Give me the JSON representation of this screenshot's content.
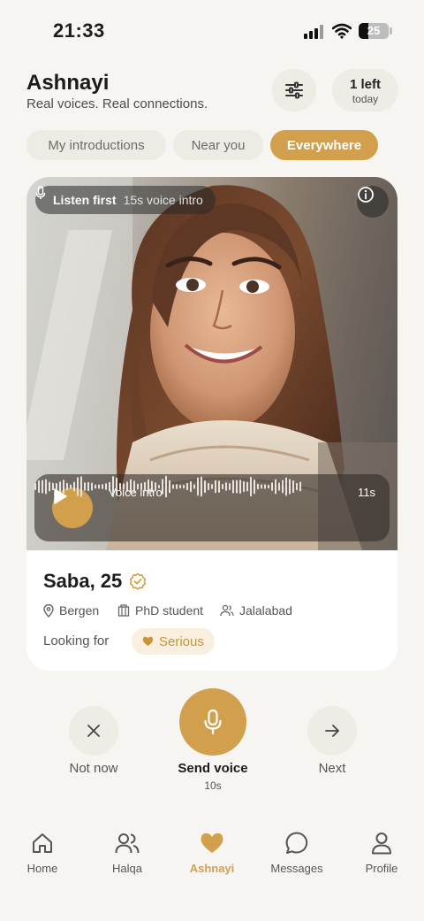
{
  "status_bar": {
    "time": "21:33",
    "battery": "25"
  },
  "header": {
    "app_name": "Ashnayi",
    "tagline": "Real voices. Real connections.",
    "remaining_count": "1 left",
    "remaining_period": "today"
  },
  "tabs": [
    {
      "label": "My introductions",
      "active": false
    },
    {
      "label": "Near you",
      "active": false
    },
    {
      "label": "Everywhere",
      "active": true
    }
  ],
  "profile": {
    "chip_title": "Listen first",
    "chip_subtitle": "15s voice intro",
    "voice_label": "Voice intro",
    "voice_duration": "11s",
    "name_age": "Saba, 25",
    "location": "Bergen",
    "occupation": "PhD student",
    "origin": "Jalalabad",
    "looking_for_label": "Looking for",
    "looking_for_value": "Serious"
  },
  "actions": {
    "not_now": "Not now",
    "send_voice": "Send voice",
    "send_voice_duration": "10s",
    "next": "Next"
  },
  "nav": [
    {
      "label": "Home",
      "icon": "home-icon",
      "active": false
    },
    {
      "label": "Halqa",
      "icon": "people-icon",
      "active": false
    },
    {
      "label": "Ashnayi",
      "icon": "heart-icon",
      "active": true
    },
    {
      "label": "Messages",
      "icon": "chat-bubble-icon",
      "active": false
    },
    {
      "label": "Profile",
      "icon": "person-icon",
      "active": false
    }
  ],
  "colors": {
    "accent": "#d2a04c",
    "background": "#f7f5f1",
    "card": "#ffffff",
    "chip_bg": "#efece6"
  }
}
